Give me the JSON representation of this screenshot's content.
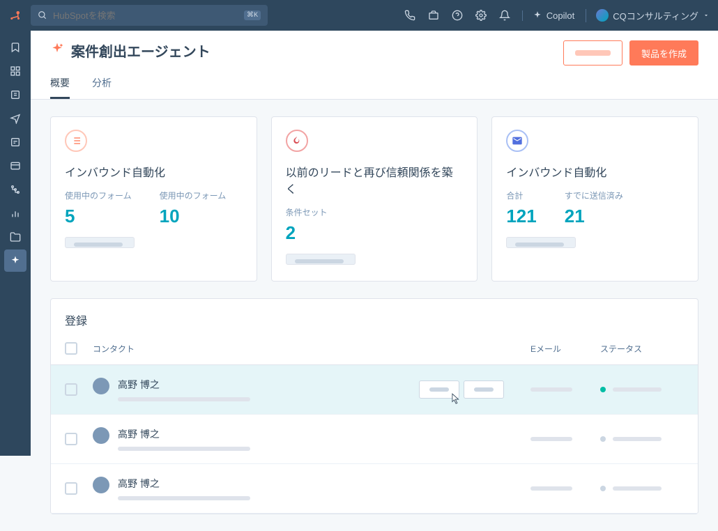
{
  "topbar": {
    "search_placeholder": "HubSpotを検索",
    "search_shortcut": "⌘K",
    "copilot_label": "Copilot",
    "account_label": "CQコンサルティング"
  },
  "page": {
    "title": "案件創出エージェント",
    "btn_primary": "製品を作成"
  },
  "tabs": [
    {
      "label": "概要",
      "active": true
    },
    {
      "label": "分析",
      "active": false
    }
  ],
  "cards": [
    {
      "icon": "list",
      "icon_color": "orange",
      "title": "インバウンド自動化",
      "stats": [
        {
          "label": "使用中のフォーム",
          "value": "5"
        },
        {
          "label": "使用中のフォーム",
          "value": "10"
        }
      ]
    },
    {
      "icon": "fire",
      "icon_color": "red",
      "title": "以前のリードと再び信頼関係を築く",
      "stats": [
        {
          "label": "条件セット",
          "value": "2"
        }
      ]
    },
    {
      "icon": "envelope",
      "icon_color": "blue",
      "title": "インバウンド自動化",
      "stats": [
        {
          "label": "合計",
          "value": "121"
        },
        {
          "label": "すでに送信済み",
          "value": "21"
        }
      ]
    }
  ],
  "table": {
    "title": "登録",
    "columns": {
      "contact": "コンタクト",
      "email": "Eメール",
      "status": "ステータス"
    },
    "rows": [
      {
        "name": "高野 博之",
        "hover": true,
        "status_color": "teal"
      },
      {
        "name": "高野 博之",
        "hover": false,
        "status_color": "grey"
      },
      {
        "name": "高野 博之",
        "hover": false,
        "status_color": "grey"
      }
    ]
  }
}
